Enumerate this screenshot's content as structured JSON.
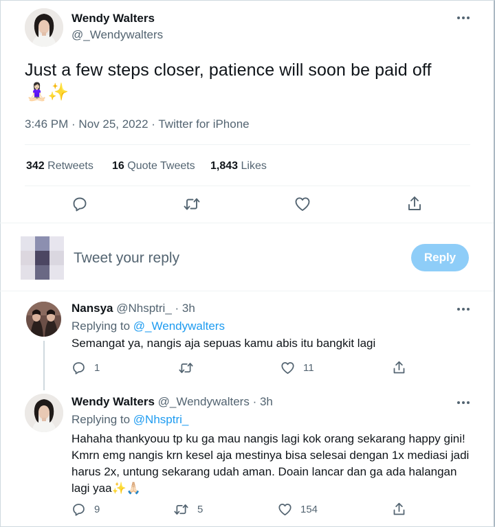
{
  "main_tweet": {
    "author_name": "Wendy Walters",
    "author_handle": "@_Wendywalters",
    "text": "Just a few steps closer, patience will soon be paid off",
    "emoji": "🧘🏻‍♀️✨",
    "meta": "3:46 PM · Nov 25, 2022 · Twitter for iPhone",
    "stats": {
      "retweets_num": "342",
      "retweets_label": "Retweets",
      "quotes_num": "16",
      "quotes_label": "Quote Tweets",
      "likes_num": "1,843",
      "likes_label": "Likes"
    }
  },
  "compose": {
    "placeholder": "Tweet your reply",
    "button_label": "Reply"
  },
  "replies": [
    {
      "author_name": "Nansya",
      "author_handle": "@Nhsptri_",
      "time": "· 3h",
      "replying_prefix": "Replying to",
      "replying_to": "@_Wendywalters",
      "text": "Semangat ya, nangis aja sepuas kamu abis itu bangkit lagi",
      "reply_count": "1",
      "retweet_count": "",
      "like_count": "11"
    },
    {
      "author_name": "Wendy Walters",
      "author_handle": "@_Wendywalters",
      "time": "· 3h",
      "replying_prefix": "Replying to",
      "replying_to": "@Nhsptri_",
      "text_lines": [
        "Hahaha thankyouu tp ku ga mau nangis lagi kok orang sekarang happy gini!",
        "Kmrn emg nangis krn kesel aja mestinya bisa selesai dengan 1x mediasi jadi",
        "harus 2x, untung sekarang udah aman. Doain lancar dan ga ada halangan",
        "lagi yaa✨🙏🏻"
      ],
      "reply_count": "9",
      "retweet_count": "5",
      "like_count": "154"
    }
  ],
  "icons": [
    "reply-icon",
    "retweet-icon",
    "like-icon",
    "share-icon",
    "more-icon"
  ],
  "colors": {
    "accent": "#1d9bf0",
    "reply_button": "#8ecdf8",
    "text": "#0f1419",
    "muted": "#536471",
    "divider": "#eff3f4"
  }
}
